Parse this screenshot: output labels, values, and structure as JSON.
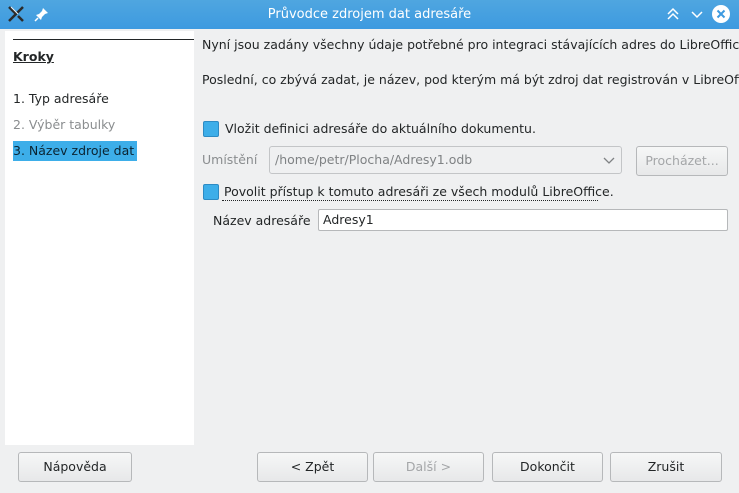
{
  "window": {
    "title": "Průvodce zdrojem dat adresáře",
    "accent": "#3d9ae0"
  },
  "sidebar": {
    "heading": "Kroky",
    "steps": [
      {
        "label": "1. Typ adresáře",
        "state": "done"
      },
      {
        "label": "2. Výběr tabulky",
        "state": "disabled"
      },
      {
        "label": "3. Název zdroje dat",
        "state": "selected"
      }
    ]
  },
  "main": {
    "intro": "Nyní jsou zadány všechny údaje potřebné pro integraci stávajících adres do LibreOffice.",
    "intro2": "Poslední, co zbývá zadat, je název, pod kterým má být zdroj dat registrován v LibreOffice.",
    "embed_checkbox_label": "Vložit definici adresáře do aktuálního dokumentu.",
    "embed_checked": true,
    "location_label": "Umístění",
    "location_value": "/home/petr/Plocha/Adresy1.odb",
    "browse_label": "Procházet...",
    "access_checkbox_label": "Povolit přístup k tomuto adresáři ze všech modulů LibreOffice.",
    "access_checked": true,
    "name_label": "Název adresáře",
    "name_value": "Adresy1"
  },
  "buttons": {
    "help": "Nápověda",
    "back": "< Zpět",
    "next": "Další >",
    "finish": "Dokončit",
    "cancel": "Zrušit"
  }
}
